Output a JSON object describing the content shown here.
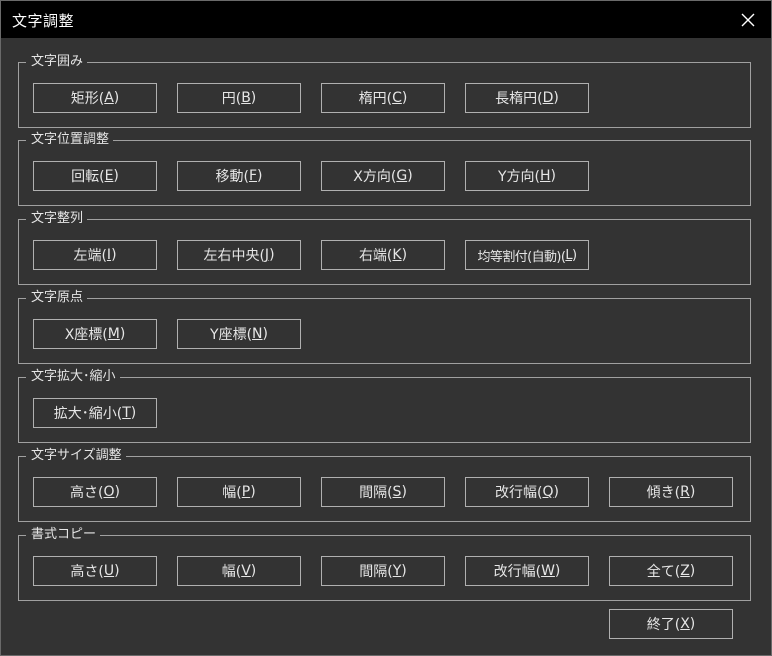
{
  "window": {
    "title": "文字調整"
  },
  "groups": [
    {
      "label": "文字囲み",
      "buttons": [
        {
          "pre": "矩形(",
          "key": "A",
          "post": ")"
        },
        {
          "pre": "円(",
          "key": "B",
          "post": ")"
        },
        {
          "pre": "楕円(",
          "key": "C",
          "post": ")"
        },
        {
          "pre": "長楕円(",
          "key": "D",
          "post": ")"
        }
      ]
    },
    {
      "label": "文字位置調整",
      "buttons": [
        {
          "pre": "回転(",
          "key": "E",
          "post": ")"
        },
        {
          "pre": "移動(",
          "key": "F",
          "post": ")"
        },
        {
          "pre": "X方向(",
          "key": "G",
          "post": ")"
        },
        {
          "pre": "Y方向(",
          "key": "H",
          "post": ")"
        }
      ]
    },
    {
      "label": "文字整列",
      "buttons": [
        {
          "pre": "左端(",
          "key": "I",
          "post": ")"
        },
        {
          "pre": "左右中央(",
          "key": "J",
          "post": ")"
        },
        {
          "pre": "右端(",
          "key": "K",
          "post": ")"
        },
        {
          "pre": "均等割付(自動)(",
          "key": "L",
          "post": ")"
        }
      ]
    },
    {
      "label": "文字原点",
      "buttons": [
        {
          "pre": "X座標(",
          "key": "M",
          "post": ")"
        },
        {
          "pre": "Y座標(",
          "key": "N",
          "post": ")"
        }
      ]
    },
    {
      "label": "文字拡大･縮小",
      "buttons": [
        {
          "pre": "拡大･縮小(",
          "key": "T",
          "post": ")"
        }
      ]
    },
    {
      "label": "文字サイズ調整",
      "buttons": [
        {
          "pre": "高さ(",
          "key": "O",
          "post": ")"
        },
        {
          "pre": "幅(",
          "key": "P",
          "post": ")"
        },
        {
          "pre": "間隔(",
          "key": "S",
          "post": ")"
        },
        {
          "pre": "改行幅(",
          "key": "Q",
          "post": ")"
        },
        {
          "pre": "傾き(",
          "key": "R",
          "post": ")"
        }
      ]
    },
    {
      "label": "書式コピー",
      "buttons": [
        {
          "pre": "高さ(",
          "key": "U",
          "post": ")"
        },
        {
          "pre": "幅(",
          "key": "V",
          "post": ")"
        },
        {
          "pre": "間隔(",
          "key": "Y",
          "post": ")"
        },
        {
          "pre": "改行幅(",
          "key": "W",
          "post": ")"
        },
        {
          "pre": "全て(",
          "key": "Z",
          "post": ")"
        }
      ]
    }
  ],
  "exit_button": {
    "pre": "終了(",
    "key": "X",
    "post": ")"
  }
}
